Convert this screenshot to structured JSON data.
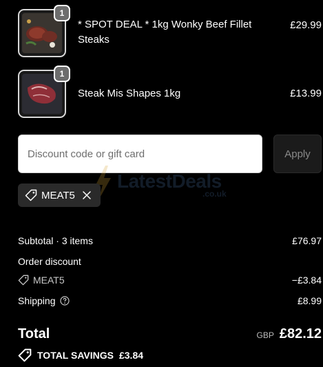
{
  "cart": {
    "items": [
      {
        "quantity": "1",
        "name": "* SPOT DEAL * 1kg Wonky Beef Fillet Steaks",
        "price": "£29.99",
        "thumbnail": "beef-fillet-steaks-image"
      },
      {
        "quantity": "1",
        "name": "Steak Mis Shapes 1kg",
        "price": "£13.99",
        "thumbnail": "steak-mis-shapes-image"
      }
    ]
  },
  "discount": {
    "placeholder": "Discount code or gift card",
    "value": "",
    "apply_label": "Apply",
    "applied_code": "MEAT5"
  },
  "watermark": {
    "main": "LatestDeals",
    "sub": ".co.uk"
  },
  "summary": {
    "subtotal_label": "Subtotal · 3 items",
    "subtotal_value": "£76.97",
    "order_discount_label": "Order discount",
    "discount_code": "MEAT5",
    "discount_value": "−£3.84",
    "shipping_label": "Shipping",
    "shipping_value": "£8.99",
    "total_label": "Total",
    "currency": "GBP",
    "total_value": "£82.12",
    "savings_label": "TOTAL SAVINGS",
    "savings_value": "£3.84"
  },
  "icons": [
    "tag-icon",
    "close-icon",
    "help-circle-icon",
    "tag-icon",
    "lightning-bolt-icon"
  ],
  "colors": {
    "background": "#000000",
    "input_bg": "#ffffff",
    "apply_bg": "#1b1b1b",
    "chip_bg": "#2a2a2a",
    "badge_bg": "#6d6d6d"
  }
}
